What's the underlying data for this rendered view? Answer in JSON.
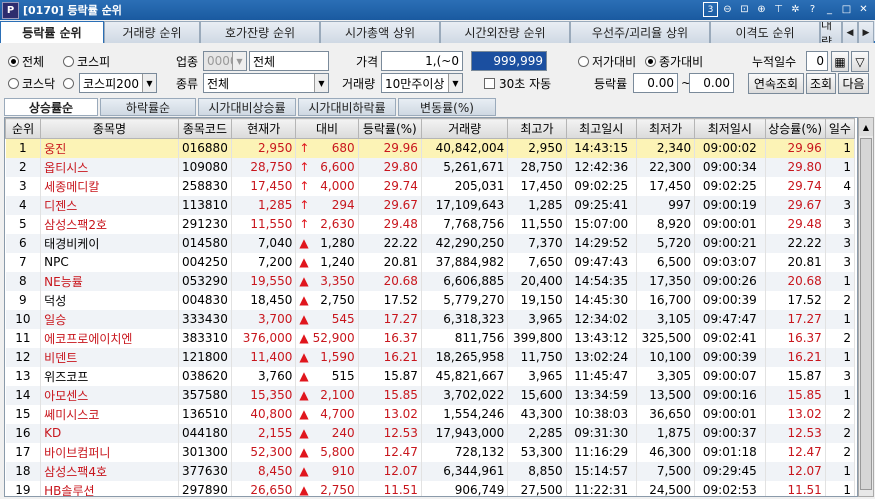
{
  "title": "[0170] 등락률 순위",
  "window_controls": {
    "num": "3",
    "help": "?",
    "min": "_",
    "max": "□",
    "close": "✕"
  },
  "main_tabs": [
    "등락률 순위",
    "거래량 순위",
    "호가잔량 순위",
    "시가총액 상위",
    "시간외잔량 순위",
    "우선주/괴리율 상위",
    "이격도 순위",
    "대량"
  ],
  "filters": {
    "market1": "전체",
    "market2": "코스피",
    "market3": "코스닥",
    "index": "코스피200",
    "industry_label": "업종",
    "industry_code": "0000",
    "industry_name": "전체",
    "type_label": "종류",
    "type_value": "전체",
    "price_label": "가격",
    "price_from": "1,(~0",
    "price_to": "999,999",
    "volume_label": "거래량",
    "volume_value": "10만주이상",
    "auto_label": "30초 자동",
    "low_label": "저가대비",
    "close_label": "종가대비",
    "days_label": "누적일수",
    "days_value": "0",
    "rate_label": "등락률",
    "rate_from": "0.00",
    "rate_sep": "~",
    "rate_to": "0.00",
    "btn_continuous": "연속조회",
    "btn_query": "조회",
    "btn_next": "다음"
  },
  "sub_tabs": [
    "상승률순",
    "하락률순",
    "시가대비상승률",
    "시가대비하락률",
    "변동률(%)"
  ],
  "columns": [
    "순위",
    "종목명",
    "종목코드",
    "현재가",
    "대비",
    "등락률(%)",
    "거래량",
    "최고가",
    "최고일시",
    "최저가",
    "최저일시",
    "상승률(%)",
    "일수"
  ],
  "rows": [
    {
      "rank": "1",
      "name": "웅진",
      "code": "016880",
      "price": "2,950",
      "sym": "↑",
      "diff": "680",
      "rate": "29.96",
      "vol": "40,842,004",
      "high": "2,950",
      "htime": "14:43:15",
      "low": "2,340",
      "ltime": "09:00:02",
      "rise": "29.96",
      "days": "1",
      "color": "red"
    },
    {
      "rank": "2",
      "name": "옵티시스",
      "code": "109080",
      "price": "28,750",
      "sym": "↑",
      "diff": "6,600",
      "rate": "29.80",
      "vol": "5,261,671",
      "high": "28,750",
      "htime": "12:42:36",
      "low": "22,300",
      "ltime": "09:00:34",
      "rise": "29.80",
      "days": "1",
      "color": "red"
    },
    {
      "rank": "3",
      "name": "세종메디칼",
      "code": "258830",
      "price": "17,450",
      "sym": "↑",
      "diff": "4,000",
      "rate": "29.74",
      "vol": "205,031",
      "high": "17,450",
      "htime": "09:02:25",
      "low": "17,450",
      "ltime": "09:02:25",
      "rise": "29.74",
      "days": "4",
      "color": "red"
    },
    {
      "rank": "4",
      "name": "디젠스",
      "code": "113810",
      "price": "1,285",
      "sym": "↑",
      "diff": "294",
      "rate": "29.67",
      "vol": "17,109,643",
      "high": "1,285",
      "htime": "09:25:41",
      "low": "997",
      "ltime": "09:00:19",
      "rise": "29.67",
      "days": "3",
      "color": "red"
    },
    {
      "rank": "5",
      "name": "삼성스팩2호",
      "code": "291230",
      "price": "11,550",
      "sym": "↑",
      "diff": "2,630",
      "rate": "29.48",
      "vol": "7,768,756",
      "high": "11,550",
      "htime": "15:07:00",
      "low": "8,920",
      "ltime": "09:00:01",
      "rise": "29.48",
      "days": "3",
      "color": "red"
    },
    {
      "rank": "6",
      "name": "태경비케이",
      "code": "014580",
      "price": "7,040",
      "sym": "▲",
      "diff": "1,280",
      "rate": "22.22",
      "vol": "42,290,250",
      "high": "7,370",
      "htime": "14:29:52",
      "low": "5,720",
      "ltime": "09:00:21",
      "rise": "22.22",
      "days": "3",
      "color": "blk"
    },
    {
      "rank": "7",
      "name": "NPC",
      "code": "004250",
      "price": "7,200",
      "sym": "▲",
      "diff": "1,240",
      "rate": "20.81",
      "vol": "37,884,982",
      "high": "7,650",
      "htime": "09:47:43",
      "low": "6,500",
      "ltime": "09:03:07",
      "rise": "20.81",
      "days": "3",
      "color": "blk"
    },
    {
      "rank": "8",
      "name": "NE능률",
      "code": "053290",
      "price": "19,550",
      "sym": "▲",
      "diff": "3,350",
      "rate": "20.68",
      "vol": "6,606,885",
      "high": "20,400",
      "htime": "14:54:35",
      "low": "17,350",
      "ltime": "09:00:26",
      "rise": "20.68",
      "days": "1",
      "color": "red"
    },
    {
      "rank": "9",
      "name": "덕성",
      "code": "004830",
      "price": "18,450",
      "sym": "▲",
      "diff": "2,750",
      "rate": "17.52",
      "vol": "5,779,270",
      "high": "19,150",
      "htime": "14:45:30",
      "low": "16,700",
      "ltime": "09:00:39",
      "rise": "17.52",
      "days": "2",
      "color": "blk"
    },
    {
      "rank": "10",
      "name": "일승",
      "code": "333430",
      "price": "3,700",
      "sym": "▲",
      "diff": "545",
      "rate": "17.27",
      "vol": "6,318,323",
      "high": "3,965",
      "htime": "12:34:02",
      "low": "3,105",
      "ltime": "09:47:47",
      "rise": "17.27",
      "days": "1",
      "color": "red"
    },
    {
      "rank": "11",
      "name": "에코프로에이치엔",
      "code": "383310",
      "price": "376,000",
      "sym": "▲",
      "diff": "52,900",
      "rate": "16.37",
      "vol": "811,756",
      "high": "399,800",
      "htime": "13:43:12",
      "low": "325,500",
      "ltime": "09:02:41",
      "rise": "16.37",
      "days": "2",
      "color": "red"
    },
    {
      "rank": "12",
      "name": "비덴트",
      "code": "121800",
      "price": "11,400",
      "sym": "▲",
      "diff": "1,590",
      "rate": "16.21",
      "vol": "18,265,958",
      "high": "11,750",
      "htime": "13:02:24",
      "low": "10,100",
      "ltime": "09:00:39",
      "rise": "16.21",
      "days": "1",
      "color": "red"
    },
    {
      "rank": "13",
      "name": "위즈코프",
      "code": "038620",
      "price": "3,760",
      "sym": "▲",
      "diff": "515",
      "rate": "15.87",
      "vol": "45,821,667",
      "high": "3,965",
      "htime": "11:45:47",
      "low": "3,305",
      "ltime": "09:00:07",
      "rise": "15.87",
      "days": "3",
      "color": "blk"
    },
    {
      "rank": "14",
      "name": "아모센스",
      "code": "357580",
      "price": "15,350",
      "sym": "▲",
      "diff": "2,100",
      "rate": "15.85",
      "vol": "3,702,022",
      "high": "15,600",
      "htime": "13:34:59",
      "low": "13,500",
      "ltime": "09:00:16",
      "rise": "15.85",
      "days": "1",
      "color": "red"
    },
    {
      "rank": "15",
      "name": "쎄미시스코",
      "code": "136510",
      "price": "40,800",
      "sym": "▲",
      "diff": "4,700",
      "rate": "13.02",
      "vol": "1,554,246",
      "high": "43,300",
      "htime": "10:38:03",
      "low": "36,650",
      "ltime": "09:00:01",
      "rise": "13.02",
      "days": "2",
      "color": "red"
    },
    {
      "rank": "16",
      "name": "KD",
      "code": "044180",
      "price": "2,155",
      "sym": "▲",
      "diff": "240",
      "rate": "12.53",
      "vol": "17,943,000",
      "high": "2,285",
      "htime": "09:31:30",
      "low": "1,875",
      "ltime": "09:00:37",
      "rise": "12.53",
      "days": "2",
      "color": "red"
    },
    {
      "rank": "17",
      "name": "바이브컴퍼니",
      "code": "301300",
      "price": "52,300",
      "sym": "▲",
      "diff": "5,800",
      "rate": "12.47",
      "vol": "728,132",
      "high": "53,300",
      "htime": "11:16:29",
      "low": "46,300",
      "ltime": "09:01:18",
      "rise": "12.47",
      "days": "2",
      "color": "red"
    },
    {
      "rank": "18",
      "name": "삼성스팩4호",
      "code": "377630",
      "price": "8,450",
      "sym": "▲",
      "diff": "910",
      "rate": "12.07",
      "vol": "6,344,961",
      "high": "8,850",
      "htime": "15:14:57",
      "low": "7,500",
      "ltime": "09:29:45",
      "rise": "12.07",
      "days": "1",
      "color": "red"
    },
    {
      "rank": "19",
      "name": "HB솔루션",
      "code": "297890",
      "price": "26,650",
      "sym": "▲",
      "diff": "2,750",
      "rate": "11.51",
      "vol": "906,749",
      "high": "27,500",
      "htime": "11:22:31",
      "low": "24,500",
      "ltime": "09:02:53",
      "rise": "11.51",
      "days": "1",
      "color": "red"
    },
    {
      "rank": "20",
      "name": "신성통상",
      "code": "005390",
      "price": "4,030",
      "sym": "▲",
      "diff": "410",
      "rate": "11.33",
      "vol": "47,558,988",
      "high": "4,335",
      "htime": "13:50:30",
      "low": "3,525",
      "ltime": "09:09:57",
      "rise": "11.33",
      "days": "3",
      "color": "blk"
    }
  ]
}
